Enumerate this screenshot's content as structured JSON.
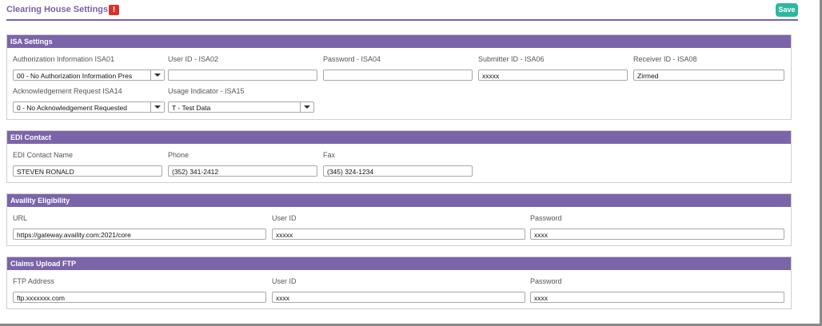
{
  "page": {
    "title": "Clearing House Settings",
    "warning_glyph": "!",
    "save_label": "Save",
    "accent_color": "#7b64a9",
    "save_color": "#2cb8a0",
    "warning_color": "#d8312a"
  },
  "isa": {
    "heading": "ISA Settings",
    "auth_info": {
      "label": "Authorization Information ISA01",
      "value": "00 - No Authorization Information Pres"
    },
    "user_id": {
      "label": "User ID - ISA02",
      "value": ""
    },
    "password": {
      "label": "Password - ISA04",
      "value": ""
    },
    "submitter_id": {
      "label": "Submitter ID - ISA06",
      "value": "xxxxx"
    },
    "receiver_id": {
      "label": "Receiver ID - ISA08",
      "value": "Zirmed"
    },
    "ack_request": {
      "label": "Acknowledgement Request ISA14",
      "value": "0 -  No Acknowledgement Requested"
    },
    "usage_indicator": {
      "label": "Usage Indicator - ISA15",
      "value": "T - Test Data"
    }
  },
  "edi": {
    "heading": "EDI Contact",
    "contact_name": {
      "label": "EDI Contact Name",
      "value": "STEVEN RONALD"
    },
    "phone": {
      "label": "Phone",
      "value": "(352) 341-2412"
    },
    "fax": {
      "label": "Fax",
      "value": "(345) 324-1234"
    }
  },
  "availity": {
    "heading": "Availity Eligibility",
    "url": {
      "label": "URL",
      "value": "https://gateway.availity.com:2021/core"
    },
    "user_id": {
      "label": "User ID",
      "value": "xxxxx"
    },
    "password": {
      "label": "Password",
      "value": "xxxx"
    }
  },
  "ftp": {
    "heading": "Claims Upload FTP",
    "address": {
      "label": "FTP Address",
      "value": "ftp.xxxxxxx.com"
    },
    "user_id": {
      "label": "User ID",
      "value": "xxxx"
    },
    "password": {
      "label": "Password",
      "value": "xxxx"
    }
  },
  "icons": {
    "warning": "warning-icon",
    "dropdown": "chevron-down-icon"
  }
}
